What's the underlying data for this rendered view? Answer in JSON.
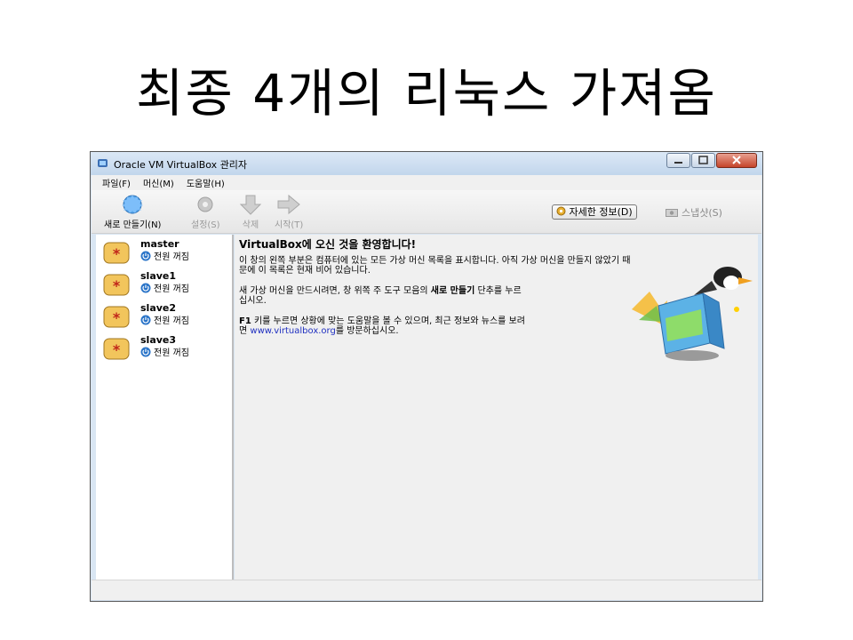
{
  "slide": {
    "title": "최종 4개의 리눅스 가져옴"
  },
  "window": {
    "title": "Oracle VM VirtualBox 관리자",
    "controls": {
      "minimize": "minimize",
      "maximize": "maximize",
      "close": "close"
    }
  },
  "menu": {
    "items": [
      "파일(F)",
      "머신(M)",
      "도움말(H)"
    ]
  },
  "toolbar": {
    "new_label": "새로 만들기(N)",
    "settings_label": "설정(S)",
    "discard_label": "삭제",
    "start_label": "시작(T)",
    "details_label": "자세한 정보(D)",
    "snapshots_label": "스냅샷(S)"
  },
  "vms": [
    {
      "name": "master",
      "state": "전원 꺼짐"
    },
    {
      "name": "slave1",
      "state": "전원 꺼짐"
    },
    {
      "name": "slave2",
      "state": "전원 꺼짐"
    },
    {
      "name": "slave3",
      "state": "전원 꺼짐"
    }
  ],
  "welcome": {
    "title": "VirtualBox에 오신 것을 환영합니다!",
    "p1_line1": "이 창의 왼쪽 부분은 컴퓨터에 있는 모든 가상 머신 목록을 표시합니다. 아직 가상 머신을 만들지 않았기 때",
    "p1_line2": "문에 이 목록은 현재 비어 있습니다.",
    "p2_pre": "새 가상 머신을 만드시려면, 창 위쪽 주 도구 모음의 ",
    "p2_bold": "새로 만들기",
    "p2_post": " 단추를 누르",
    "p2_line2": "십시오.",
    "p3_bold": "F1",
    "p3_line1": " 키를 누르면 상황에 맞는 도움말을 볼 수 있으며, 최근 정보와 뉴스를 보려",
    "p3_pre2": "면 ",
    "p3_link": "www.virtualbox.org",
    "p3_post2": "를 방문하십시오."
  },
  "colors": {
    "link": "#2030c0",
    "title_bar": "#c2d6ec",
    "vm_icon": "#f2c55c",
    "close_button": "#c5442a"
  }
}
